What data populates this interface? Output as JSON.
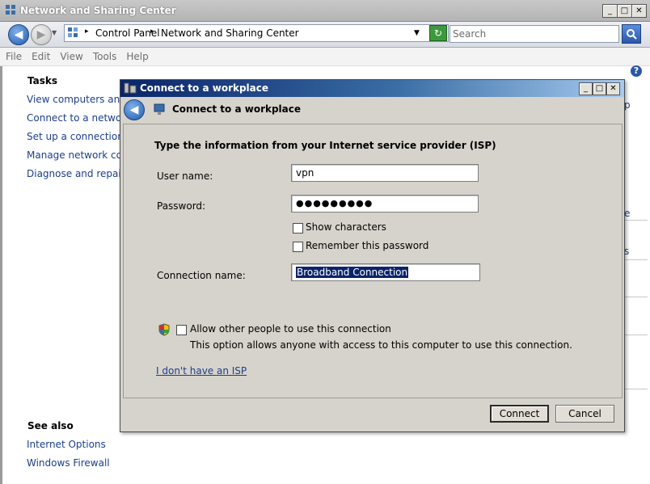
{
  "window": {
    "title": "Network and Sharing Center",
    "caption_minimize": "_",
    "caption_maximize": "□",
    "caption_close": "✕"
  },
  "address_bar": {
    "crumbs": [
      "Control Panel",
      "Network and Sharing Center"
    ],
    "separator": "▸",
    "search_placeholder": "Search"
  },
  "menu": [
    "File",
    "Edit",
    "View",
    "Tools",
    "Help"
  ],
  "help_glyph": "?",
  "sidebar": {
    "tasks_heading": "Tasks",
    "tasks": [
      "View computers and dev",
      "Connect to a network",
      "Set up a connection or n",
      "Manage network connec",
      "Diagnose and repair"
    ],
    "see_also_heading": "See also",
    "see_also": [
      "Internet Options",
      "Windows Firewall"
    ]
  },
  "right_fragments": [
    "p",
    "e",
    "s"
  ],
  "dialog": {
    "title": "Connect to a workplace",
    "header": "Connect to a workplace",
    "instruction": "Type the information from your Internet service provider (ISP)",
    "username_label": "User name:",
    "username_value": "vpn",
    "password_label": "Password:",
    "password_value": "●●●●●●●●●",
    "show_characters_label": "Show characters",
    "remember_password_label": "Remember this password",
    "connection_name_label": "Connection name:",
    "connection_name_value": "Broadband Connection",
    "allow_others_label": "Allow other people to use this connection",
    "allow_others_description": "This option allows anyone with access to this computer to use this connection.",
    "no_isp_link": "I don't have an ISP",
    "connect_button": "Connect",
    "cancel_button": "Cancel"
  },
  "colors": {
    "dialog_title_start": "#0a246a",
    "dialog_title_end": "#a6caf0",
    "link": "#1c3e8c",
    "selection": "#0a246a",
    "dialog_face": "#d6d3cc"
  }
}
